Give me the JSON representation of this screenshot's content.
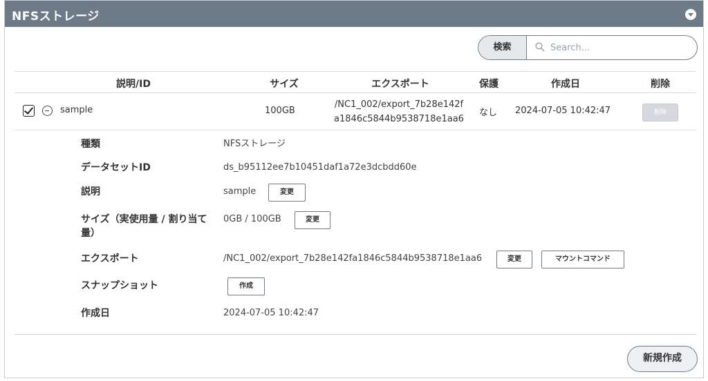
{
  "panel": {
    "title": "NFSストレージ"
  },
  "search": {
    "button_label": "検索",
    "placeholder": "Search..."
  },
  "table": {
    "headers": {
      "desc": "説明/ID",
      "size": "サイズ",
      "export": "エクスポート",
      "protect": "保護",
      "created": "作成日",
      "delete": "削除"
    },
    "row": {
      "checked": true,
      "name": "sample",
      "size": "100GB",
      "export_line1": "/NC1_002/export_7b28e142f",
      "export_line2": "a1846c5844b9538718e1aa6",
      "protect": "なし",
      "created": "2024-07-05 10:42:47",
      "delete_label": "削除"
    }
  },
  "detail": {
    "type": {
      "label": "種類",
      "value": "NFSストレージ"
    },
    "dataset_id": {
      "label": "データセットID",
      "value": "ds_b95112ee7b10451daf1a72e3dcbdd60e"
    },
    "description": {
      "label": "説明",
      "value": "sample",
      "button": "変更"
    },
    "size": {
      "label_line1": "サイズ（実使用量 / 割り当て",
      "label_line2": "量）",
      "value": "0GB / 100GB",
      "button": "変更"
    },
    "export": {
      "label": "エクスポート",
      "value": "/NC1_002/export_7b28e142fa1846c5844b9538718e1aa6",
      "button": "変更",
      "mount_button": "マウントコマンド"
    },
    "snapshot": {
      "label": "スナップショット",
      "button": "作成"
    },
    "created": {
      "label": "作成日",
      "value": "2024-07-05 10:42:47"
    }
  },
  "footer": {
    "new_button": "新規作成"
  }
}
